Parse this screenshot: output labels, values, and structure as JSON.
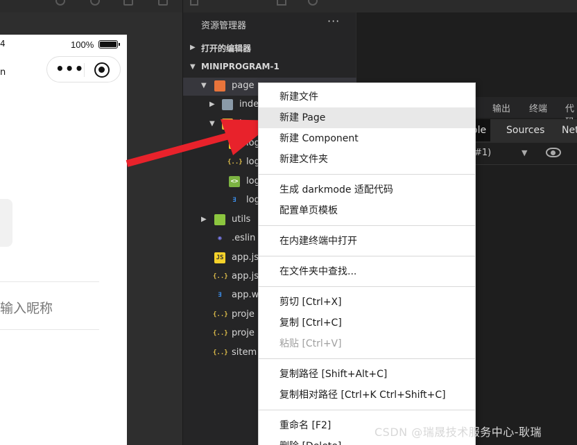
{
  "simulator": {
    "battery_text": "100%",
    "status_left": "4",
    "nav_left": "n",
    "capsule_dots": "•••",
    "nickname_placeholder": "输入昵称"
  },
  "explorer": {
    "title": "资源管理器",
    "more": "···",
    "sections": [
      {
        "label": "打开的编辑器"
      },
      {
        "label": "MINIPROGRAM-1"
      }
    ],
    "tree": [
      {
        "label": "pages",
        "shown": "page"
      },
      {
        "label": "index",
        "shown": "inde"
      },
      {
        "label": "logs",
        "shown": "l"
      },
      {
        "label": "logs.js",
        "shown": "log"
      },
      {
        "label": "logs.json",
        "shown": "log"
      },
      {
        "label": "logs.wxml",
        "shown": "log"
      },
      {
        "label": "logs.wxss",
        "shown": "log"
      },
      {
        "label": "utils",
        "shown": "utils"
      },
      {
        "label": ".eslintrc.js",
        "shown": ".eslin"
      },
      {
        "label": "app.js",
        "shown": "app.js"
      },
      {
        "label": "app.json",
        "shown": "app.js"
      },
      {
        "label": "app.wxss",
        "shown": "app.w"
      },
      {
        "label": "project.config.json",
        "shown": "proje"
      },
      {
        "label": "project.private.config.json",
        "shown": "proje"
      },
      {
        "label": "sitemap.json",
        "shown": "sitem"
      }
    ]
  },
  "right_panel": {
    "tabs": [
      "输出",
      "终端",
      "代码"
    ],
    "devtools_tabs": [
      "ole",
      "Sources",
      "Netw"
    ],
    "context_text": "#1)"
  },
  "context_menu": {
    "items": [
      {
        "label": "新建文件"
      },
      {
        "label": "新建 Page",
        "highlighted": true
      },
      {
        "label": "新建 Component"
      },
      {
        "label": "新建文件夹"
      },
      {
        "label": "生成 darkmode 适配代码"
      },
      {
        "label": "配置单页模板"
      },
      {
        "label": "在内建终端中打开"
      },
      {
        "label": "在文件夹中查找..."
      },
      {
        "label": "剪切  [Ctrl+X]"
      },
      {
        "label": "复制  [Ctrl+C]"
      },
      {
        "label": "粘贴  [Ctrl+V]",
        "disabled": true
      },
      {
        "label": "复制路径  [Shift+Alt+C]"
      },
      {
        "label": "复制相对路径  [Ctrl+K Ctrl+Shift+C]"
      },
      {
        "label": "重命名  [F2]"
      },
      {
        "label": "删除  [Delete]"
      }
    ]
  },
  "watermark": "CSDN @瑞晟技术服务中心-耿瑞",
  "colors": {
    "annotation_arrow": "#e8222b",
    "menu_highlight": "#e8e8e8",
    "explorer_bg": "#252526"
  }
}
